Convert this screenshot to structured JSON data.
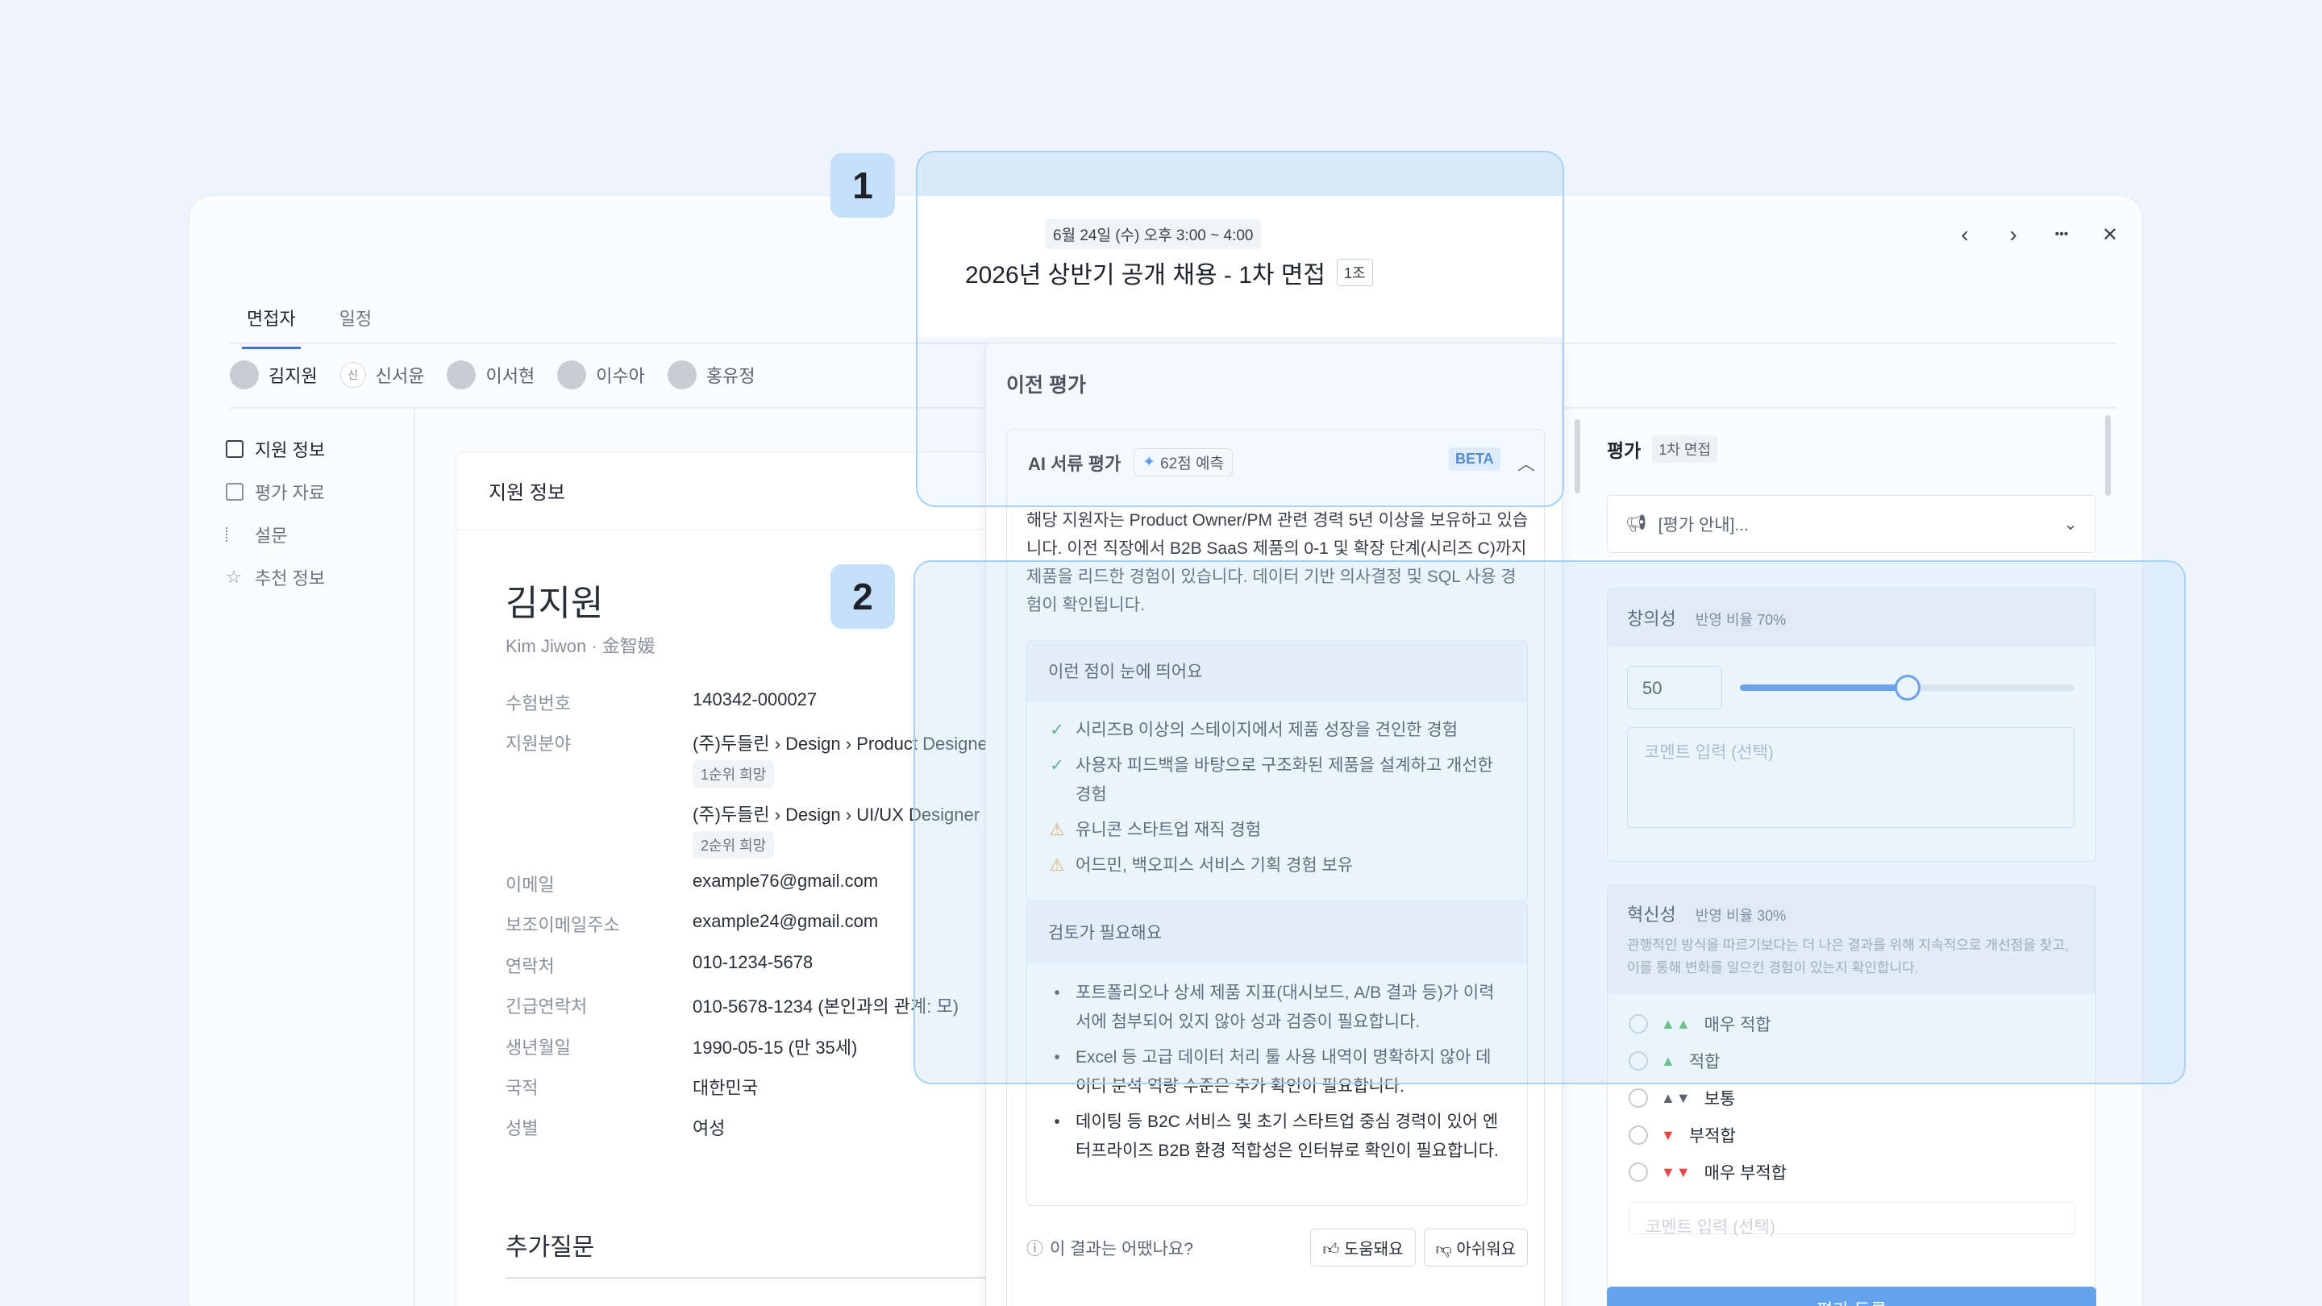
{
  "nav": {
    "prev": "‹",
    "next": "›",
    "more": "•••",
    "close": "✕"
  },
  "tabs": [
    {
      "label": "면접자"
    },
    {
      "label": "일정"
    }
  ],
  "candidates": [
    {
      "name": "김지원"
    },
    {
      "name": "신서윤",
      "initial": "신"
    },
    {
      "name": "이서현"
    },
    {
      "name": "이수아"
    },
    {
      "name": "홍유정"
    }
  ],
  "sidebar": {
    "items": [
      {
        "label": "지원 정보"
      },
      {
        "label": "평가 자료"
      },
      {
        "label": "설문"
      },
      {
        "label": "추천 정보"
      }
    ]
  },
  "applicant": {
    "card_title": "지원 정보",
    "name": "김지원",
    "name_sub": "Kim Jiwon · 金智媛",
    "rows": {
      "exam_no": {
        "label": "수험번호",
        "value": "140342-000027"
      },
      "field": {
        "label": "지원분야",
        "value1": "(주)두들린 › Design › Product Designer",
        "pref1": "1순위 희망",
        "value2": "(주)두들린 › Design › UI/UX Designer",
        "pref2": "2순위 희망"
      },
      "email": {
        "label": "이메일",
        "value": "example76@gmail.com"
      },
      "email2": {
        "label": "보조이메일주소",
        "value": "example24@gmail.com"
      },
      "phone": {
        "label": "연락처",
        "value": "010-1234-5678"
      },
      "emergency": {
        "label": "긴급연락처",
        "value": "010-5678-1234 (본인과의 관계: 모)"
      },
      "birth": {
        "label": "생년월일",
        "value": "1990-05-15 (만 35세)"
      },
      "nation": {
        "label": "국적",
        "value": "대한민국"
      },
      "gender": {
        "label": "성별",
        "value": "여성"
      }
    },
    "additional": "추가질문"
  },
  "interview": {
    "date": "6월 24일 (수) 오후 3:00 ~ 4:00",
    "title": "2026년 상반기 공개 채용 - 1차 면접",
    "group": "1조"
  },
  "prev_eval": {
    "title": "이전 평가",
    "ai_title": "AI 서류 평가",
    "ai_score": "62점 예측",
    "beta": "BETA",
    "summary": "해당 지원자는 Product Owner/PM 관련 경력 5년 이상을 보유하고 있습니다. 이전 직장에서 B2B SaaS 제품의 0-1 및 확장 단계(시리즈 C)까지 제품을 리드한 경험이 있습니다. 데이터 기반 의사결정 및 SQL 사용 경험이 확인됩니다.",
    "highlights_title": "이런 점이 눈에 띄어요",
    "highlights": [
      {
        "type": "ok",
        "text": "시리즈B 이상의 스테이지에서 제품 성장을 견인한 경험"
      },
      {
        "type": "ok",
        "text": "사용자 피드백을 바탕으로 구조화된 제품을 설계하고 개선한 경험"
      },
      {
        "type": "warn",
        "text": "유니콘 스타트업 재직 경험"
      },
      {
        "type": "warn",
        "text": "어드민, 백오피스 서비스 기획 경험 보유"
      }
    ],
    "review_title": "검토가 필요해요",
    "review": [
      {
        "text": "포트폴리오나 상세 제품 지표(대시보드, A/B 결과 등)가 이력서에 첨부되어 있지 않아 성과 검증이 필요합니다."
      },
      {
        "text": "Excel 등 고급 데이터 처리 툴 사용 내역이 명확하지 않아 데이터 분석 역량 수준은 추가 확인이 필요합니다."
      },
      {
        "text": "데이팅 등 B2C 서비스 및 초기 스타트업 중심 경력이 있어 엔터프라이즈 B2B 환경 적합성은 인터뷰로 확인이 필요합니다."
      }
    ],
    "feedback_q": "이 결과는 어땠나요?",
    "helpful": "도움돼요",
    "not_helpful": "아쉬워요"
  },
  "evaluation": {
    "title": "평가",
    "stage": "1차 면접",
    "guide": "[평가 안내]...",
    "creativity": {
      "label": "창의성",
      "weight": "반영 비율 70%",
      "score": "50",
      "score_fraction": 0.5,
      "comment_placeholder": "코멘트 입력 (선택)"
    },
    "innovation": {
      "label": "혁신성",
      "weight": "반영 비율 30%",
      "desc": "관행적인 방식을 따르기보다는 더 나은 결과를 위해 지속적으로 개선점을 찾고, 이를 통해 변화를 일으킨 경험이 있는지 확인합니다.",
      "options": [
        {
          "label": "매우 적합",
          "icon": "double-thumbs-up-icon"
        },
        {
          "label": "적합",
          "icon": "thumbs-up-icon"
        },
        {
          "label": "보통",
          "icon": "thumbs-neutral-icon"
        },
        {
          "label": "부적합",
          "icon": "thumbs-down-icon"
        },
        {
          "label": "매우 부적합",
          "icon": "double-thumbs-down-icon"
        }
      ],
      "comment_placeholder": "코멘트 입력 (선택)"
    },
    "submit": "평가 등록"
  },
  "callouts": [
    {
      "label": "1"
    },
    {
      "label": "2"
    }
  ]
}
